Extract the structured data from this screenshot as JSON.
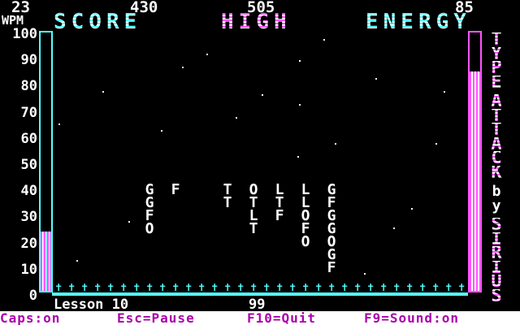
{
  "header": {
    "wpm_value": "23",
    "score_value": "430",
    "high_value": "505",
    "energy_value": "85",
    "wpm_label": "WPM",
    "score_label": "SCORE",
    "high_label": "HIGH",
    "energy_label": "ENERGY"
  },
  "y_axis": [
    "100",
    "90",
    "80",
    "70",
    "60",
    "50",
    "40",
    "30",
    "20",
    "10",
    "0"
  ],
  "wpm_meter": {
    "level_percent": 23
  },
  "energy_meter": {
    "level_percent": 85
  },
  "falling_columns": [
    {
      "letters": [
        "G",
        "G",
        "F",
        "O"
      ]
    },
    {
      "letters": [
        "F"
      ]
    },
    {
      "letters": [
        "T",
        "T"
      ]
    },
    {
      "letters": [
        "O",
        "T",
        "L",
        "T"
      ]
    },
    {
      "letters": [
        "L",
        "T",
        "F"
      ]
    },
    {
      "letters": [
        "L",
        "L",
        "O",
        "F",
        "O"
      ]
    },
    {
      "letters": [
        "G",
        "F",
        "G",
        "G",
        "O",
        "G",
        "F"
      ]
    }
  ],
  "vertical_title": {
    "line1": [
      "T",
      "Y",
      "P",
      "E"
    ],
    "line2": [
      "A",
      "T",
      "T",
      "A",
      "C",
      "K"
    ],
    "line3": [
      "b",
      "y"
    ],
    "line4": [
      "S",
      "I",
      "R",
      "I",
      "U",
      "S"
    ]
  },
  "lesson_label": "Lesson 10",
  "lesson_extra": "99",
  "status_bar": {
    "caps": "Caps:on",
    "pause": "Esc=Pause",
    "quit": "F10=Quit",
    "sound": "F9=Sound:on"
  },
  "colors": {
    "cyan": "#55ffff",
    "magenta": "#ff55ff",
    "white": "#ffffff",
    "background": "#000000"
  }
}
